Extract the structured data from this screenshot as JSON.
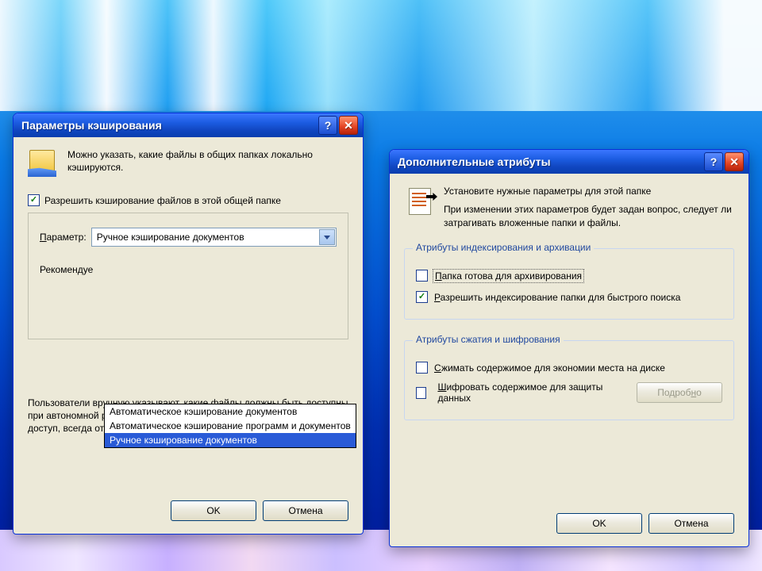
{
  "dialogs": {
    "cache": {
      "title": "Параметры кэширования",
      "intro": "Можно указать, какие файлы в общих папках локально кэшируются.",
      "allow_cache": "Разрешить кэширование файлов в этой общей папке",
      "parameter_label": "Параметр:",
      "combo_selected": "Ручное кэширование документов",
      "options": [
        "Автоматическое кэширование документов",
        "Автоматическое кэширование программ и документов",
        "Ручное кэширование документов"
      ],
      "recommended_label": "Рекомендуе",
      "description": "Пользователи вручную указывают, какие файлы должны  быть доступны при автономной работе. Чтобы обеспечить надлежащий совместный доступ, всегда открывается версия файла с сервера.",
      "ok": "OK",
      "cancel": "Отмена"
    },
    "attr": {
      "title": "Дополнительные атрибуты",
      "intro1": "Установите нужные параметры для этой папке",
      "intro2": "При изменении этих параметров будет задан вопрос, следует ли затрагивать вложенные папки и файлы.",
      "group1_legend": "Атрибуты индексирования и архивации",
      "archive_label": "Папка готова для архивирования",
      "index_label": "Разрешить индексирование папки для быстрого поиска",
      "group2_legend": "Атрибуты сжатия и шифрования",
      "compress_label": "Сжимать содержимое для экономии места на диске",
      "encrypt_label": "Шифровать содержимое для защиты данных",
      "details": "Подробно",
      "ok": "OK",
      "cancel": "Отмена"
    }
  }
}
